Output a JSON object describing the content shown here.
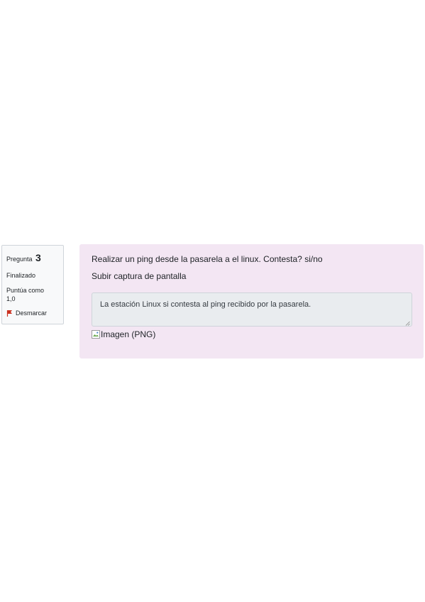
{
  "question_info": {
    "label": "Pregunta",
    "number": "3",
    "state": "Finalizado",
    "grade_label": "Puntúa como",
    "grade_value": "1,0",
    "flag_label": "Desmarcar"
  },
  "question_content": {
    "text_line1": "Realizar un ping desde la pasarela a el linux. Contesta? si/no",
    "text_line2": "Subir captura de pantalla",
    "answer_text": "La estación Linux si contesta al ping recibido por la pasarela.",
    "image_alt": "Imagen (PNG)"
  },
  "colors": {
    "content_background": "#f3e6f3",
    "info_background": "#f8f9fa",
    "answer_background": "#e9ecef",
    "flag_color": "#ca3120"
  },
  "icons": {
    "flag": "flag-icon",
    "broken_image": "broken-image-icon",
    "resize": "resize-grip-icon"
  }
}
